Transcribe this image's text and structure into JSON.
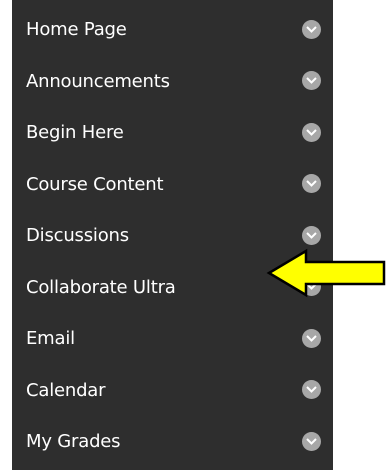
{
  "menu": {
    "items": [
      {
        "label": "Home Page"
      },
      {
        "label": "Announcements"
      },
      {
        "label": "Begin Here"
      },
      {
        "label": "Course Content"
      },
      {
        "label": "Discussions"
      },
      {
        "label": "Collaborate Ultra"
      },
      {
        "label": "Email"
      },
      {
        "label": "Calendar"
      },
      {
        "label": "My Grades"
      }
    ]
  },
  "colors": {
    "menu_background": "#2e2e2e",
    "item_text": "#ffffff",
    "chevron_circle": "#a7a7a7",
    "arrow_fill": "#ffff00",
    "arrow_stroke": "#000000"
  },
  "icons": {
    "item_chevron": "chevron-down-circle-icon",
    "annotation": "left-pointing-arrow-icon"
  }
}
